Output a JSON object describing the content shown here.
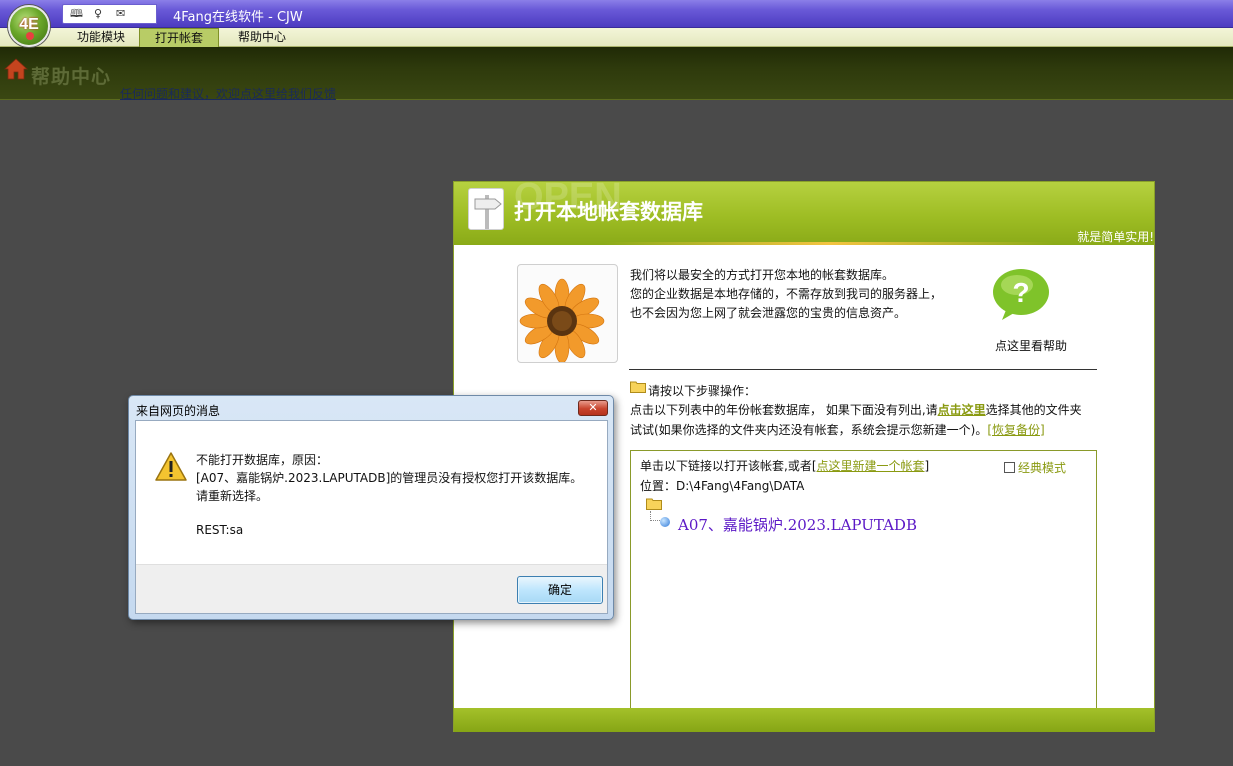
{
  "app": {
    "logo_text": "4E",
    "title": "4Fang在线软件  - CJW"
  },
  "quickbar": {
    "icons": [
      "book-icon",
      "key-icon",
      "chat-icon"
    ]
  },
  "menu": {
    "items": [
      {
        "label": "功能模块"
      },
      {
        "label": "打开帐套",
        "active": true
      },
      {
        "label": "帮助中心"
      }
    ]
  },
  "header": {
    "title": "帮助中心",
    "feedback_link": "任何问题和建议，欢迎点这里给我们反馈"
  },
  "panel": {
    "title": "打开本地帐套数据库",
    "watermark": "OPEN",
    "tagline": "就是简单实用!",
    "intro": [
      "我们将以最安全的方式打开您本地的帐套数据库。",
      "您的企业数据是本地存储的，不需存放到我司的服务器上，",
      "也不会因为您上网了就会泄露您的宝贵的信息资产。"
    ],
    "help_label": "点这里看帮助",
    "steps_title": "请按以下步骤操作：",
    "steps_line1_a": "点击以下列表中的年份帐套数据库，  如果下面没有列出,请",
    "steps_line1_link": "点击这里",
    "steps_line1_b": "选择其他的文件夹",
    "steps_line2_a": "试试(如果你选择的文件夹内还没有帐套，系统会提示您新建一个)。",
    "steps_line2_link": "[恢复备份]",
    "list": {
      "head_a": "单击以下链接以打开该帐套,或者[",
      "head_link": "点这里新建一个帐套",
      "head_b": "]",
      "classic_mode": "经典模式",
      "location": "位置：D:\\4Fang\\4Fang\\DATA",
      "db_entry": "A07、嘉能锅炉.2023.LAPUTADB"
    }
  },
  "dialog": {
    "title": "来自网页的消息",
    "close_label": "✕",
    "lines": [
      "不能打开数据库，原因：",
      "[A07、嘉能锅炉.2023.LAPUTADB]的管理员没有授权您打开该数据库。",
      "请重新选择。"
    ],
    "rest": "REST:sa",
    "ok_label": "确定"
  },
  "colors": {
    "titlebar": "#5a4acb",
    "accent_green": "#9ebd24",
    "link_green": "#8a9a11",
    "db_link": "#5b18c6"
  }
}
